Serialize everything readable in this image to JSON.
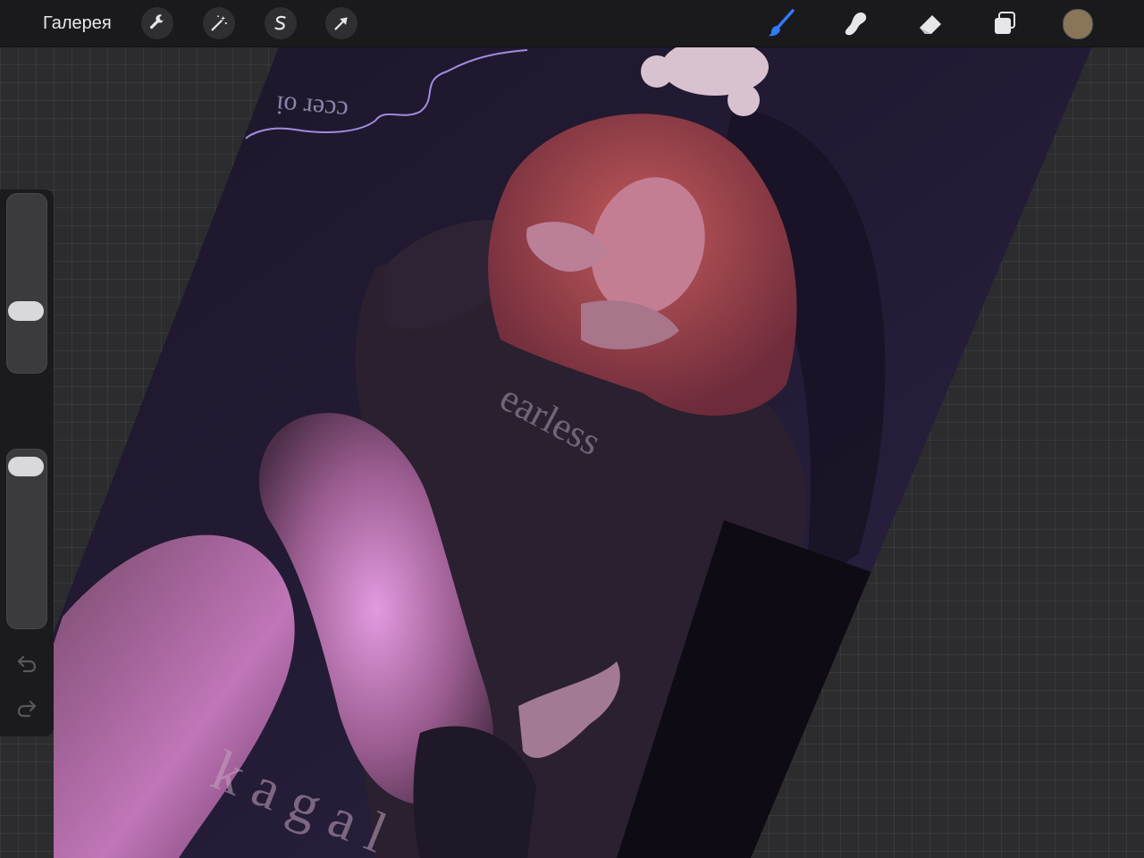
{
  "toolbar": {
    "gallery_label": "Галерея",
    "left_tools": [
      {
        "name": "actions",
        "icon": "wrench-icon"
      },
      {
        "name": "adjustments",
        "icon": "magic-wand-icon"
      },
      {
        "name": "selection",
        "icon": "selection-s-icon"
      },
      {
        "name": "transform",
        "icon": "arrow-cursor-icon"
      }
    ],
    "right_tools": [
      {
        "name": "brush",
        "icon": "brush-icon",
        "active": true
      },
      {
        "name": "smudge",
        "icon": "smudge-icon",
        "active": false
      },
      {
        "name": "eraser",
        "icon": "eraser-icon",
        "active": false
      },
      {
        "name": "layers",
        "icon": "layers-icon",
        "active": false
      }
    ],
    "current_color": "#8a7558",
    "active_color": "#2f7bff"
  },
  "sidebar": {
    "brush_size_level": 0.32,
    "opacity_level": 0.97,
    "buttons": [
      "modify-square-icon",
      "undo-icon",
      "redo-icon"
    ]
  },
  "artwork": {
    "watermark_top": "ccer oi",
    "shirt_text": "earless",
    "signature": "kagal"
  }
}
